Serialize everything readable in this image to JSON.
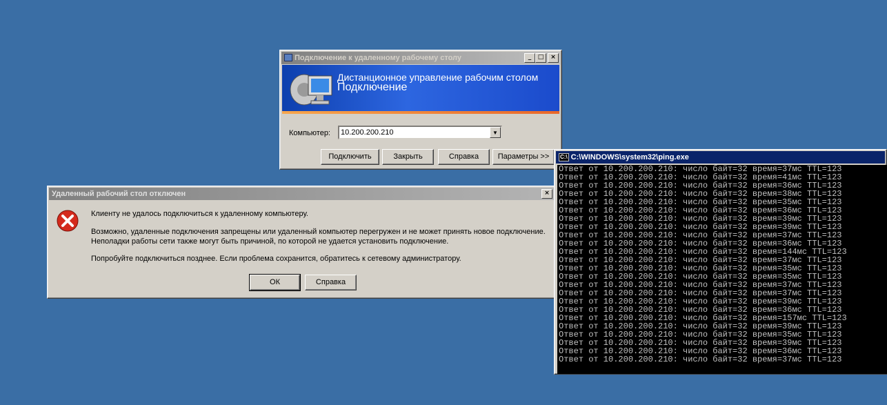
{
  "rdc": {
    "title": "Подключение к удаленному рабочему столу",
    "banner_line1": "Дистанционное управление рабочим столом",
    "banner_line2": "Подключение",
    "computer_label": "Компьютер:",
    "computer_value": "10.200.200.210",
    "buttons": {
      "connect": "Подключить",
      "close": "Закрыть",
      "help": "Справка",
      "options": "Параметры >>"
    }
  },
  "error": {
    "title": "Удаленный рабочий стол отключен",
    "line1": "Клиенту не удалось подключиться к удаленному компьютеру.",
    "line2": "Возможно, удаленные подключения запрещены или удаленный компьютер перегружен и не может принять новое подключение.",
    "line3": "Неполадки работы сети также могут быть причиной, по которой не удается установить подключение.",
    "line4": "Попробуйте подключиться позднее. Если проблема сохранится, обратитесь к сетевому администратору.",
    "ok": "ОК",
    "help": "Справка"
  },
  "console": {
    "icon_label": "C:\\",
    "title": "C:\\WINDOWS\\system32\\ping.exe",
    "lines": [
      "Ответ от 10.200.200.210: число байт=32 время=37мс TTL=123",
      "Ответ от 10.200.200.210: число байт=32 время=41мс TTL=123",
      "Ответ от 10.200.200.210: число байт=32 время=36мс TTL=123",
      "Ответ от 10.200.200.210: число байт=32 время=38мс TTL=123",
      "Ответ от 10.200.200.210: число байт=32 время=35мс TTL=123",
      "Ответ от 10.200.200.210: число байт=32 время=36мс TTL=123",
      "Ответ от 10.200.200.210: число байт=32 время=39мс TTL=123",
      "Ответ от 10.200.200.210: число байт=32 время=39мс TTL=123",
      "Ответ от 10.200.200.210: число байт=32 время=37мс TTL=123",
      "Ответ от 10.200.200.210: число байт=32 время=36мс TTL=123",
      "Ответ от 10.200.200.210: число байт=32 время=144мс TTL=123",
      "Ответ от 10.200.200.210: число байт=32 время=37мс TTL=123",
      "Ответ от 10.200.200.210: число байт=32 время=35мс TTL=123",
      "Ответ от 10.200.200.210: число байт=32 время=35мс TTL=123",
      "Ответ от 10.200.200.210: число байт=32 время=37мс TTL=123",
      "Ответ от 10.200.200.210: число байт=32 время=37мс TTL=123",
      "Ответ от 10.200.200.210: число байт=32 время=39мс TTL=123",
      "Ответ от 10.200.200.210: число байт=32 время=36мс TTL=123",
      "Ответ от 10.200.200.210: число байт=32 время=157мс TTL=123",
      "Ответ от 10.200.200.210: число байт=32 время=39мс TTL=123",
      "Ответ от 10.200.200.210: число байт=32 время=35мс TTL=123",
      "Ответ от 10.200.200.210: число байт=32 время=39мс TTL=123",
      "Ответ от 10.200.200.210: число байт=32 время=36мс TTL=123",
      "Ответ от 10.200.200.210: число байт=32 время=37мс TTL=123"
    ]
  }
}
